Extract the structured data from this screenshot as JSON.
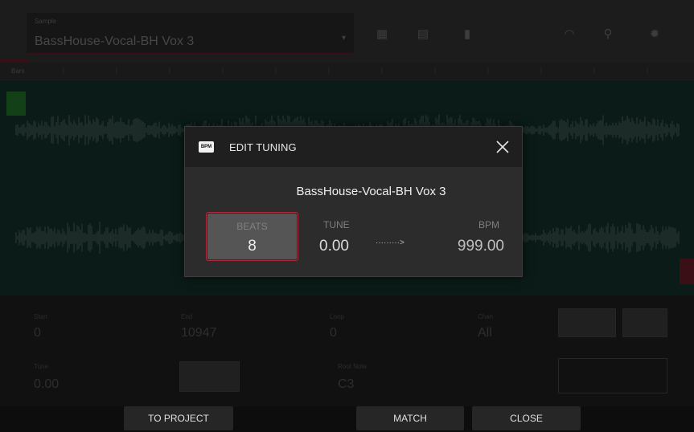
{
  "background": {
    "sample_select": {
      "label": "Sample",
      "value": "BassHouse-Vocal-BH Vox 3"
    },
    "ruler": {
      "label": "Bars"
    },
    "params": {
      "param1": {
        "label": "Start",
        "value": "0"
      },
      "param2": {
        "label": "End",
        "value": "10947"
      },
      "param3": {
        "label": "Loop",
        "value": "0"
      },
      "param4": {
        "label": "Chan",
        "value": "All"
      },
      "param5": {
        "label": "Tune",
        "value": "0.00"
      },
      "param6": {
        "label": "Root Note",
        "value": "C3"
      }
    }
  },
  "dialog": {
    "icon_text": "BPM",
    "title": "EDIT TUNING",
    "sample_name": "BassHouse-Vocal-BH Vox 3",
    "beats": {
      "label": "BEATS",
      "value": "8"
    },
    "tune": {
      "label": "TUNE",
      "value": "0.00"
    },
    "arrow": "·········>",
    "bpm": {
      "label": "BPM",
      "value": "999.00"
    }
  },
  "bottom_bar": {
    "to_project": "TO PROJECT",
    "match": "MATCH",
    "close": "CLOSE"
  },
  "colors": {
    "accent": "#b3273a",
    "dialog_bg": "#2c2c2c",
    "header_bg": "#1f1f1f"
  }
}
